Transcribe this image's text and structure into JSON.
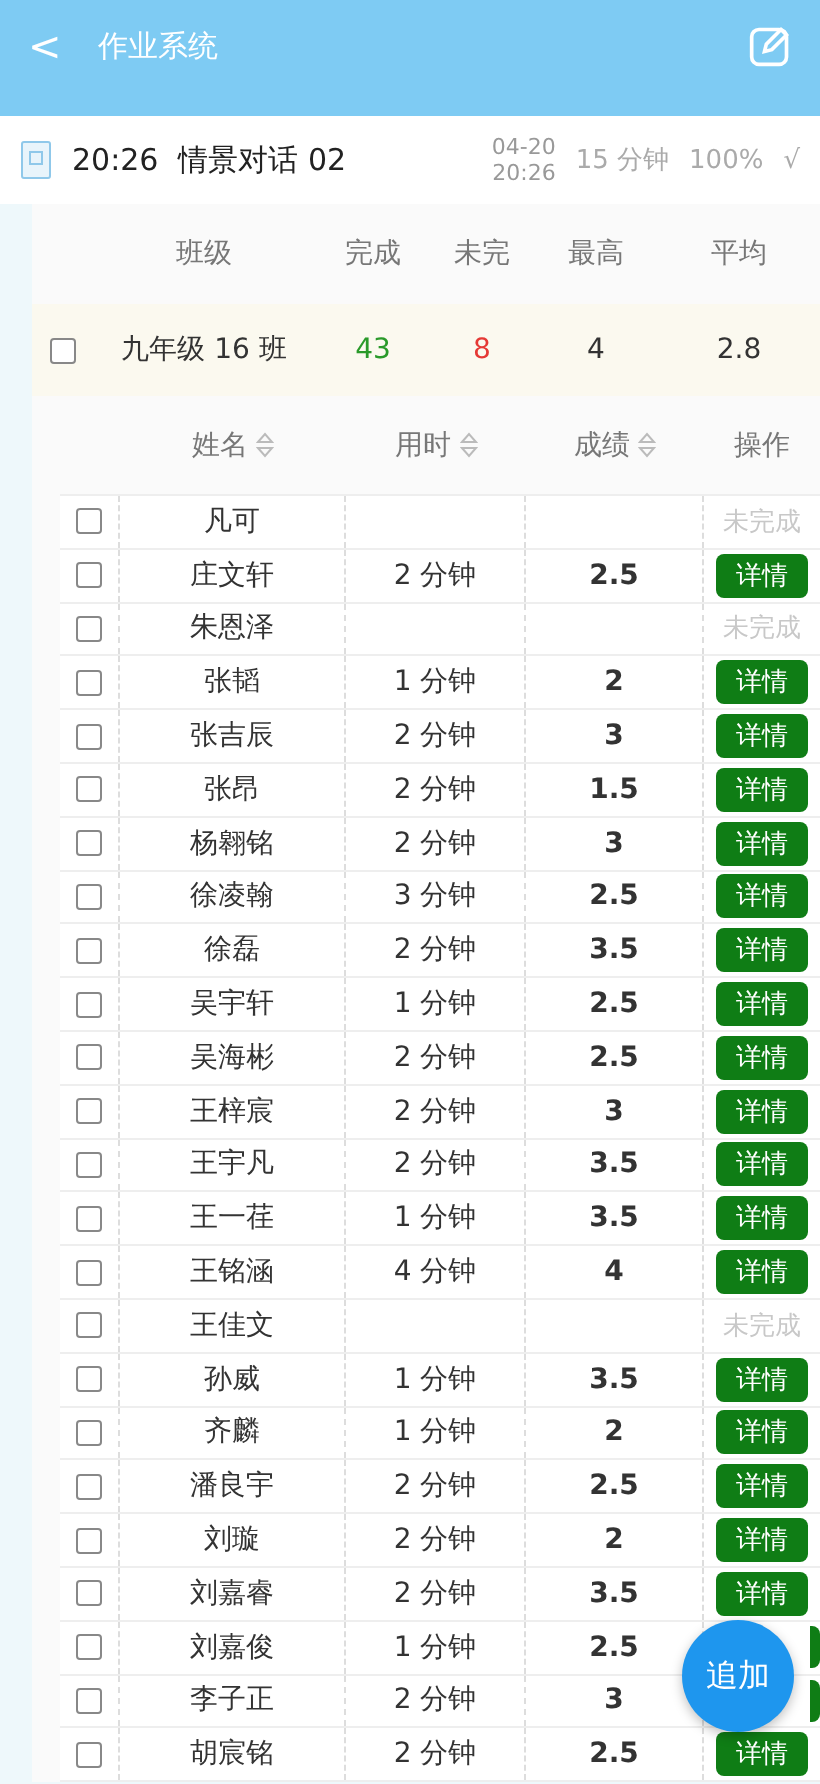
{
  "header": {
    "back": "<",
    "title": "作业系统"
  },
  "homework": {
    "time": "20:26",
    "title": "情景对话 02",
    "date": "04-20",
    "date_time": "20:26",
    "duration": "15 分钟",
    "rate": "100%",
    "mark": "√"
  },
  "summary": {
    "columns": [
      "班级",
      "完成",
      "未完",
      "最高",
      "平均"
    ],
    "rows": [
      {
        "checked": false,
        "class": "九年级 16 班",
        "done": "43",
        "undone": "8",
        "max": "4",
        "avg": "2.8"
      }
    ]
  },
  "students": {
    "columns": [
      {
        "label": "姓名",
        "sortable": true
      },
      {
        "label": "用时",
        "sortable": true
      },
      {
        "label": "成绩",
        "sortable": true
      },
      {
        "label": "操作",
        "sortable": false
      }
    ],
    "rows": [
      {
        "checked": false,
        "name": "凡可",
        "completed": false,
        "action": "未完成"
      },
      {
        "checked": false,
        "name": "庄文轩",
        "time": "2 分钟",
        "score": "2.5",
        "completed": true,
        "action": "详情"
      },
      {
        "checked": false,
        "name": "朱恩泽",
        "completed": false,
        "action": "未完成"
      },
      {
        "checked": false,
        "name": "张韬",
        "time": "1 分钟",
        "score": "2",
        "completed": true,
        "action": "详情"
      },
      {
        "checked": false,
        "name": "张吉辰",
        "time": "2 分钟",
        "score": "3",
        "completed": true,
        "action": "详情"
      },
      {
        "checked": false,
        "name": "张昂",
        "time": "2 分钟",
        "score": "1.5",
        "completed": true,
        "action": "详情"
      },
      {
        "checked": false,
        "name": "杨翱铭",
        "time": "2 分钟",
        "score": "3",
        "completed": true,
        "action": "详情"
      },
      {
        "checked": false,
        "name": "徐凌翰",
        "time": "3 分钟",
        "score": "2.5",
        "completed": true,
        "action": "详情"
      },
      {
        "checked": false,
        "name": "徐磊",
        "time": "2 分钟",
        "score": "3.5",
        "completed": true,
        "action": "详情"
      },
      {
        "checked": false,
        "name": "吴宇轩",
        "time": "1 分钟",
        "score": "2.5",
        "completed": true,
        "action": "详情"
      },
      {
        "checked": false,
        "name": "吴海彬",
        "time": "2 分钟",
        "score": "2.5",
        "completed": true,
        "action": "详情"
      },
      {
        "checked": false,
        "name": "王梓宸",
        "time": "2 分钟",
        "score": "3",
        "completed": true,
        "action": "详情"
      },
      {
        "checked": false,
        "name": "王宇凡",
        "time": "2 分钟",
        "score": "3.5",
        "completed": true,
        "action": "详情"
      },
      {
        "checked": false,
        "name": "王一荏",
        "time": "1 分钟",
        "score": "3.5",
        "completed": true,
        "action": "详情"
      },
      {
        "checked": false,
        "name": "王铭涵",
        "time": "4 分钟",
        "score": "4",
        "completed": true,
        "action": "详情"
      },
      {
        "checked": false,
        "name": "王佳文",
        "completed": false,
        "action": "未完成"
      },
      {
        "checked": false,
        "name": "孙威",
        "time": "1 分钟",
        "score": "3.5",
        "completed": true,
        "action": "详情"
      },
      {
        "checked": false,
        "name": "齐麟",
        "time": "1 分钟",
        "score": "2",
        "completed": true,
        "action": "详情"
      },
      {
        "checked": false,
        "name": "潘良宇",
        "time": "2 分钟",
        "score": "2.5",
        "completed": true,
        "action": "详情"
      },
      {
        "checked": false,
        "name": "刘璇",
        "time": "2 分钟",
        "score": "2",
        "completed": true,
        "action": "详情"
      },
      {
        "checked": false,
        "name": "刘嘉睿",
        "time": "2 分钟",
        "score": "3.5",
        "completed": true,
        "action": "详情"
      },
      {
        "checked": false,
        "name": "刘嘉俊",
        "time": "1 分钟",
        "score": "2.5",
        "completed": true
      },
      {
        "checked": false,
        "name": "李子正",
        "time": "2 分钟",
        "score": "3",
        "completed": true
      },
      {
        "checked": false,
        "name": "胡宸铭",
        "time": "2 分钟",
        "score": "2.5",
        "completed": true,
        "action": "详情"
      }
    ]
  },
  "fab": "追加"
}
